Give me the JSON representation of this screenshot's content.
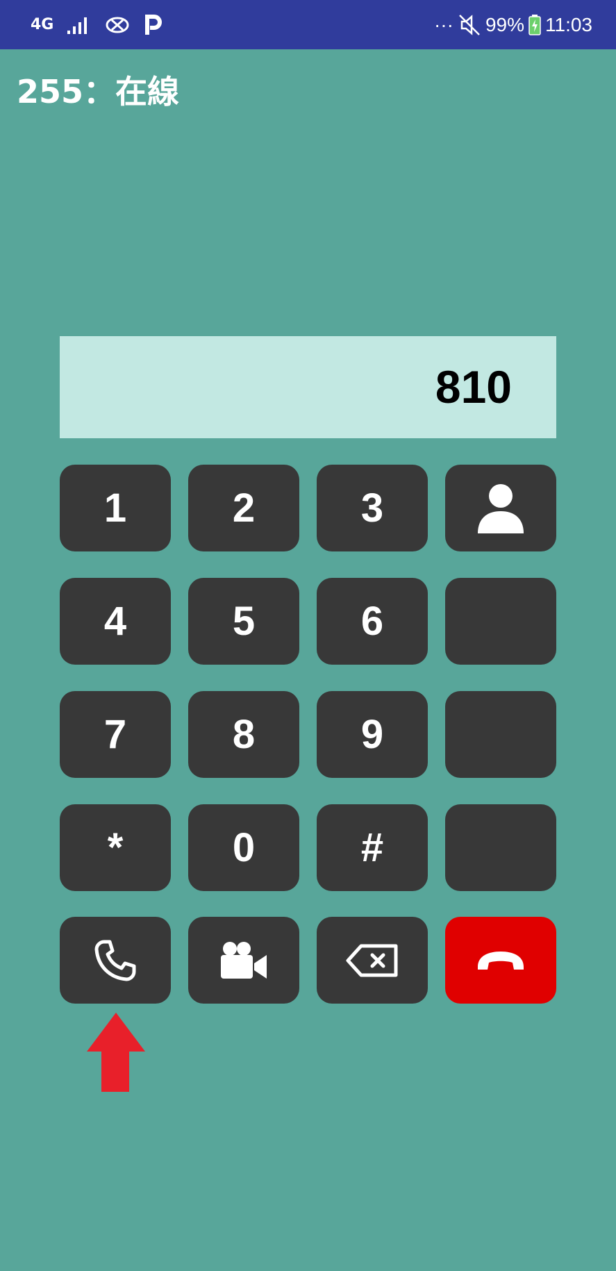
{
  "status_bar": {
    "network": "4G",
    "battery": "99%",
    "time": "11:03",
    "more": "···",
    "icons": [
      "signal-icon",
      "link-icon",
      "p-icon",
      "mute-icon",
      "battery-icon"
    ],
    "background": "#303c9c"
  },
  "header": {
    "title": "255：在線"
  },
  "dial_display": {
    "number": "810"
  },
  "keypad": {
    "keys": [
      "1",
      "2",
      "3",
      "4",
      "5",
      "6",
      "7",
      "8",
      "9",
      "*",
      "0",
      "#"
    ]
  },
  "actions": {
    "contacts_icon": "contacts-icon",
    "call_icon": "phone-icon",
    "video_icon": "video-camera-icon",
    "backspace_icon": "backspace-icon",
    "hangup_icon": "hangup-icon"
  },
  "colors": {
    "background": "#58a69a",
    "display": "#c2e8e2",
    "key": "#383838",
    "hangup": "#e00000",
    "arrow": "#e8202a"
  }
}
